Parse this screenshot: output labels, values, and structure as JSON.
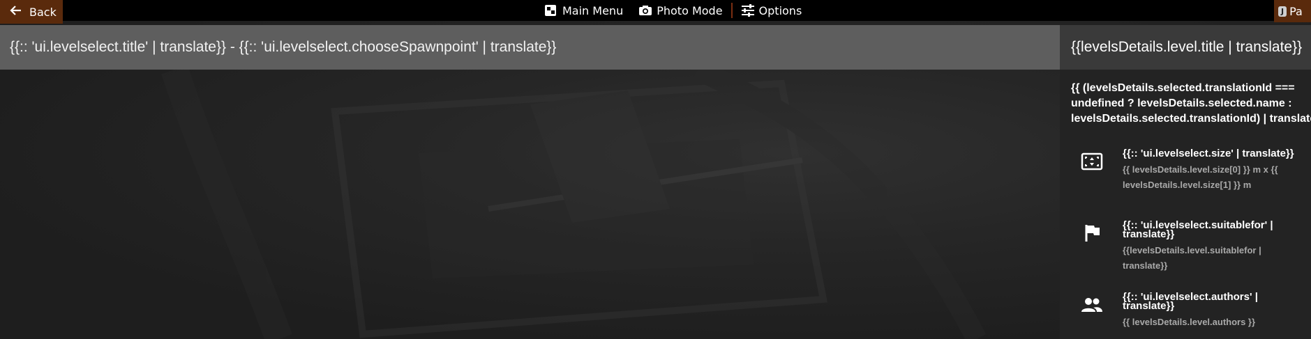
{
  "topbar": {
    "back_label": "Back",
    "main_menu_label": "Main Menu",
    "photo_mode_label": "Photo Mode",
    "options_label": "Options",
    "pause_key": "J",
    "pause_label": "Pa",
    "accent_color": "#5a2a0c"
  },
  "header": {
    "title": "{{:: 'ui.levelselect.title' | translate}} - {{:: 'ui.levelselect.chooseSpawnpoint' | translate}}"
  },
  "panel": {
    "title": "{{levelsDetails.level.title | translate}}",
    "selected_name": "{{ (levelsDetails.selected.translationId ===\nundefined ? levelsDetails.selected.name :\nlevelsDetails.selected.translationId) | translate",
    "details": [
      {
        "icon": "size-frame-icon",
        "label": "{{:: 'ui.levelselect.size' | translate}}",
        "value": "{{ levelsDetails.level.size[0] }} m x {{\nlevelsDetails.level.size[1] }} m"
      },
      {
        "icon": "flag-icon",
        "label": "{{:: 'ui.levelselect.suitablefor' |\ntranslate}}",
        "value": "{{levelsDetails.level.suitablefor |\ntranslate}}"
      },
      {
        "icon": "people-icon",
        "label": "{{:: 'ui.levelselect.authors' |\ntranslate}}",
        "value": "{{ levelsDetails.level.authors }}"
      }
    ]
  }
}
